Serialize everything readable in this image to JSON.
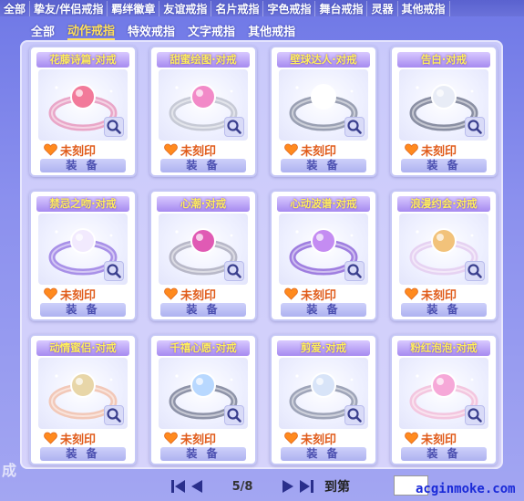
{
  "top_tabs": [
    "全部",
    "挚友/伴侣戒指",
    "羁绊徽章",
    "友谊戒指",
    "名片戒指",
    "字色戒指",
    "舞台戒指",
    "灵器",
    "其他戒指"
  ],
  "sub_tabs": [
    "全部",
    "动作戒指",
    "特效戒指",
    "文字戒指",
    "其他戒指"
  ],
  "active_sub_tab": "动作戒指",
  "cards": [
    {
      "title": "花藤诗篇·对戒",
      "status": "未刻印",
      "equip": "装 备",
      "gem": "#f27a9a",
      "band": "#e9a6c8"
    },
    {
      "title": "甜蜜绘图·对戒",
      "status": "未刻印",
      "equip": "装 备",
      "gem": "#f28ac8",
      "band": "#c7cad6"
    },
    {
      "title": "壁球达人·对戒",
      "status": "未刻印",
      "equip": "装 备",
      "gem": "#ffffff",
      "band": "#9aa0b3"
    },
    {
      "title": "告白·对戒",
      "status": "未刻印",
      "equip": "装 备",
      "gem": "#e8ecf6",
      "band": "#8a8fa3"
    },
    {
      "title": "禁忌之吻·对戒",
      "status": "未刻印",
      "equip": "装 备",
      "gem": "#f2eafe",
      "band": "#a890e8"
    },
    {
      "title": "心潮·对戒",
      "status": "未刻印",
      "equip": "装 备",
      "gem": "#e05ab4",
      "band": "#b8b8c8"
    },
    {
      "title": "心动波谱·对戒",
      "status": "未刻印",
      "equip": "装 备",
      "gem": "#c48cf2",
      "band": "#9f7ee0"
    },
    {
      "title": "浪漫约会·对戒",
      "status": "未刻印",
      "equip": "装 备",
      "gem": "#f2c27a",
      "band": "#e6d2f2"
    },
    {
      "title": "动情蜜侣·对戒",
      "status": "未刻印",
      "equip": "装 备",
      "gem": "#e8d6a8",
      "band": "#f2c8b8"
    },
    {
      "title": "千禧心愿·对戒",
      "status": "未刻印",
      "equip": "装 备",
      "gem": "#b8d8ff",
      "band": "#8e93a8"
    },
    {
      "title": "剪爱·对戒",
      "status": "未刻印",
      "equip": "装 备",
      "gem": "#d8e4f8",
      "band": "#9ea4b8"
    },
    {
      "title": "粉红泡泡·对戒",
      "status": "未刻印",
      "equip": "装 备",
      "gem": "#f6a8d8",
      "band": "#f3c6df"
    }
  ],
  "pager": {
    "page": "5/8",
    "goto_label": "到第"
  },
  "side_text": "成",
  "watermark": "acginmoke.com"
}
